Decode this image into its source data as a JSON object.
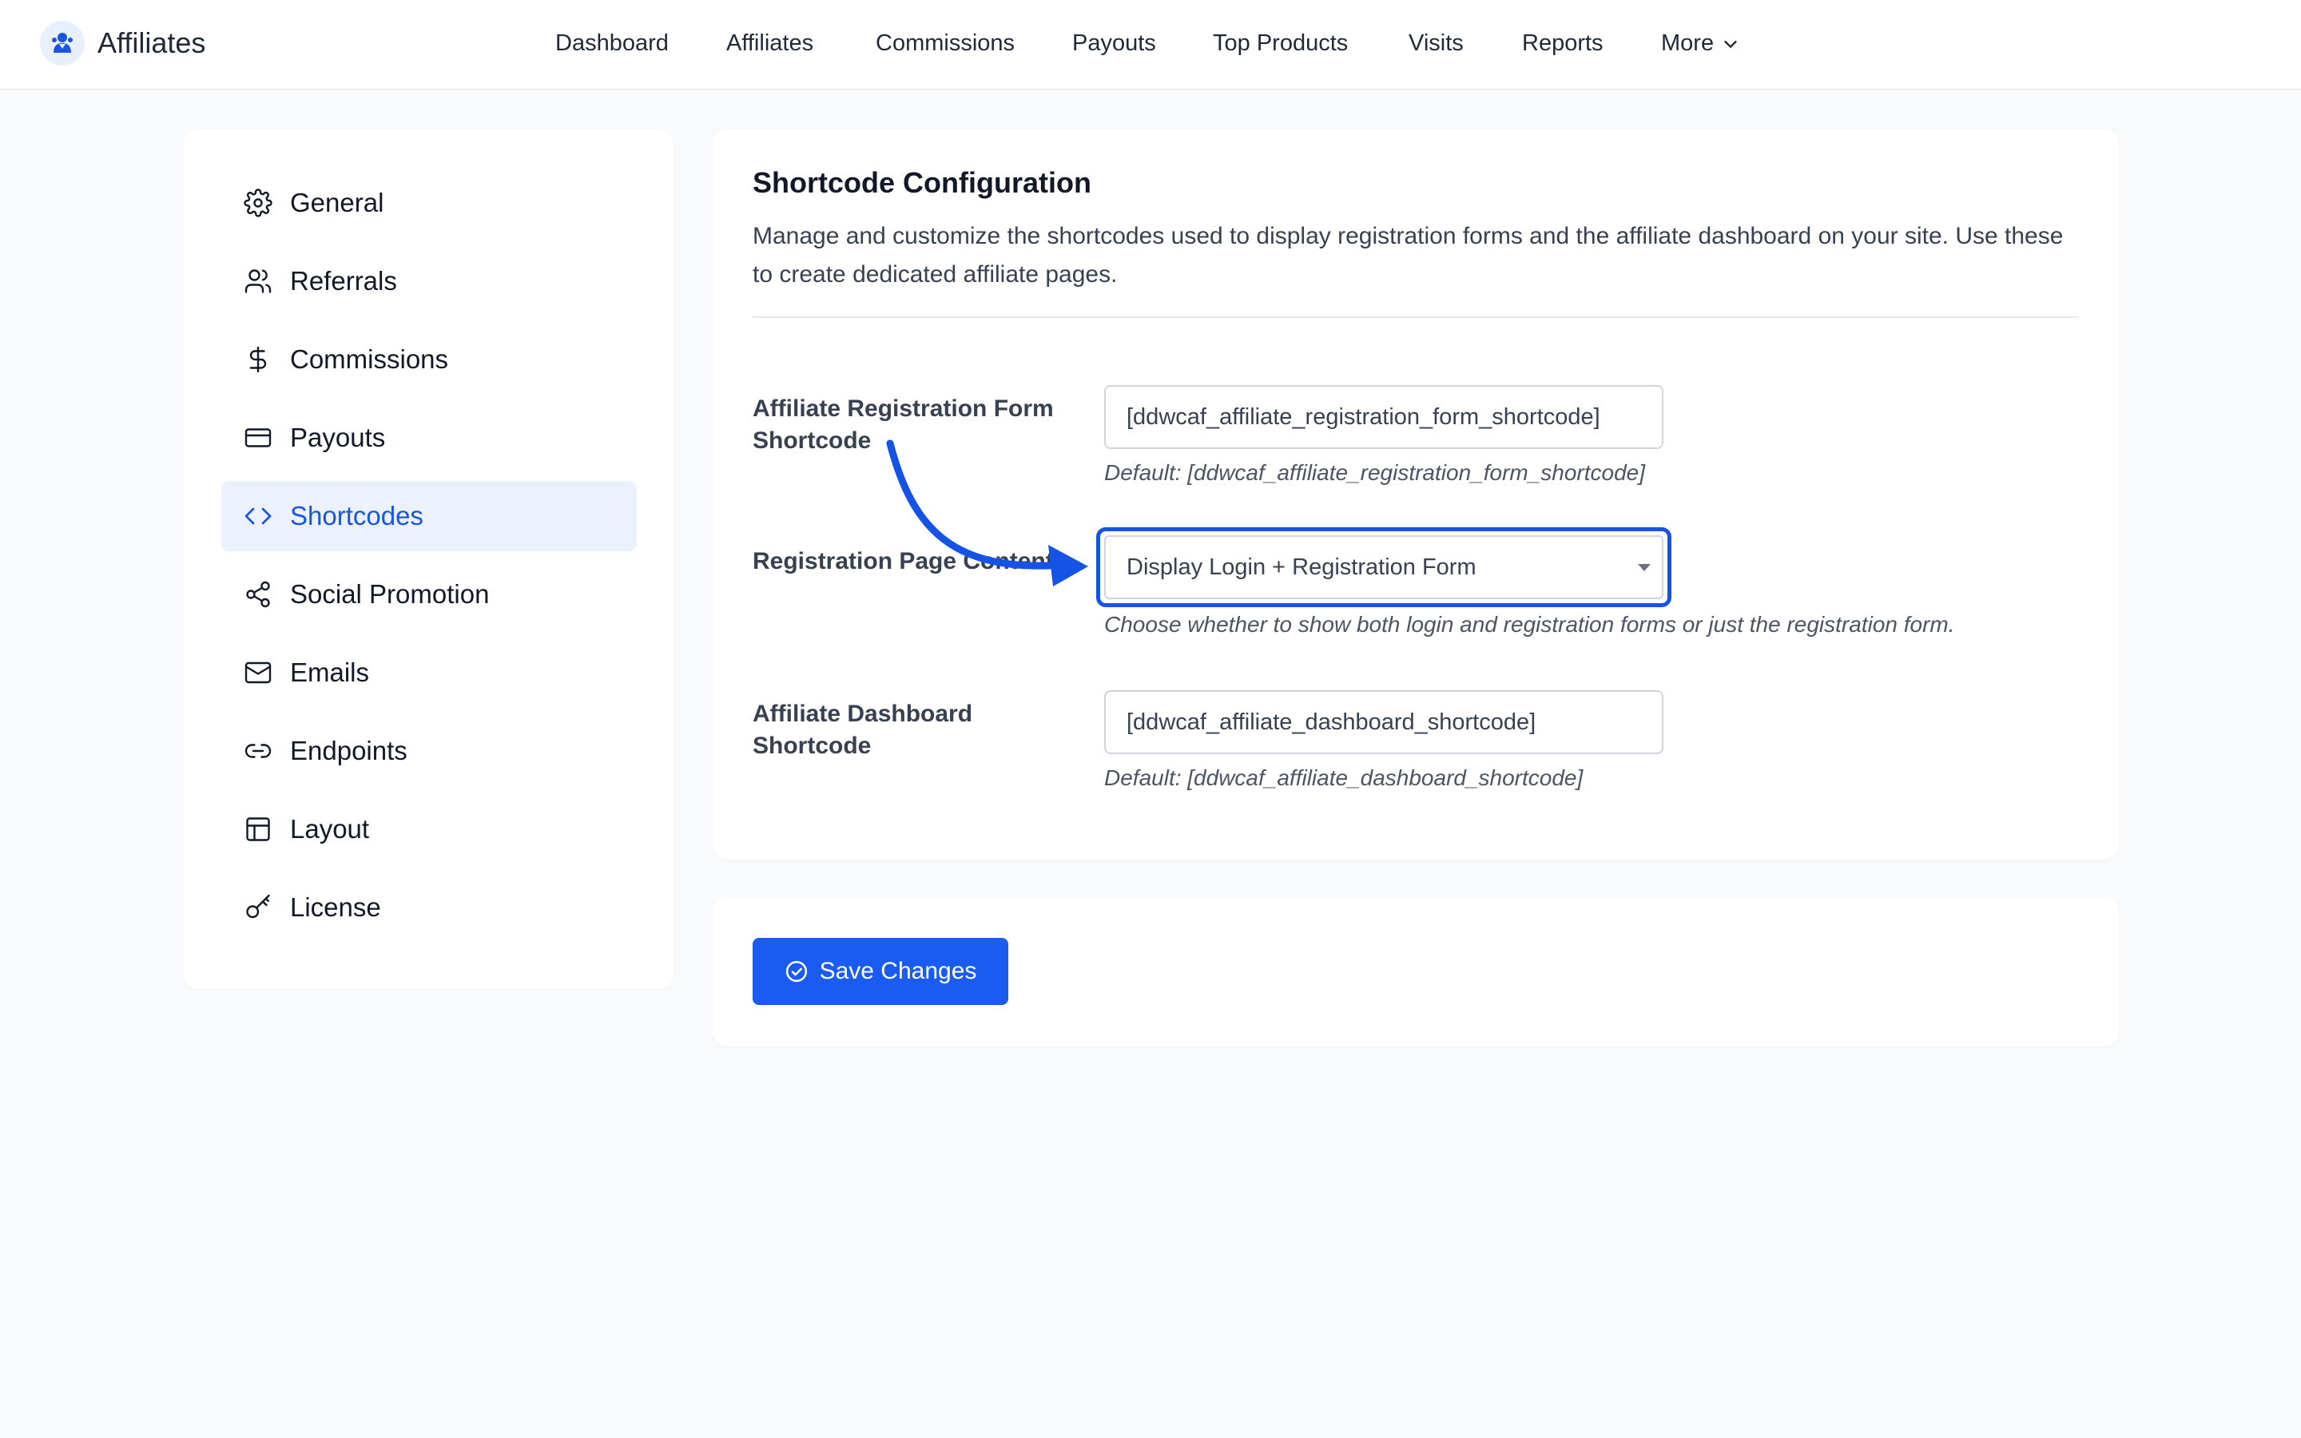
{
  "app": {
    "title": "Affiliates"
  },
  "nav": {
    "items": [
      "Dashboard",
      "Affiliates",
      "Commissions",
      "Payouts",
      "Top Products",
      "Visits",
      "Reports"
    ],
    "more_label": "More"
  },
  "sidebar": {
    "items": [
      {
        "label": "General",
        "icon": "gear-icon"
      },
      {
        "label": "Referrals",
        "icon": "users-icon"
      },
      {
        "label": "Commissions",
        "icon": "dollar-icon"
      },
      {
        "label": "Payouts",
        "icon": "credit-card-icon"
      },
      {
        "label": "Shortcodes",
        "icon": "code-icon",
        "active": true
      },
      {
        "label": "Social Promotion",
        "icon": "share-icon"
      },
      {
        "label": "Emails",
        "icon": "mail-icon"
      },
      {
        "label": "Endpoints",
        "icon": "link-icon"
      },
      {
        "label": "Layout",
        "icon": "layout-icon"
      },
      {
        "label": "License",
        "icon": "key-icon"
      }
    ]
  },
  "main": {
    "title": "Shortcode Configuration",
    "description": "Manage and customize the shortcodes used to display registration forms and the affiliate dashboard on your site. Use these to create dedicated affiliate pages.",
    "fields": {
      "registration_form": {
        "label": "Affiliate Registration Form Shortcode",
        "value": "[ddwcaf_affiliate_registration_form_shortcode]",
        "hint": "Default: [ddwcaf_affiliate_registration_form_shortcode]"
      },
      "page_content": {
        "label": "Registration Page Content",
        "selected": "Display Login + Registration Form",
        "hint": "Choose whether to show both login and registration forms or just the registration form."
      },
      "dashboard": {
        "label": "Affiliate Dashboard Shortcode",
        "value": "[ddwcaf_affiliate_dashboard_shortcode]",
        "hint": "Default: [ddwcaf_affiliate_dashboard_shortcode]"
      }
    }
  },
  "save": {
    "label": "Save Changes"
  },
  "colors": {
    "accent": "#1a56db",
    "button": "#1a5cf2",
    "highlight": "#1552e6"
  }
}
